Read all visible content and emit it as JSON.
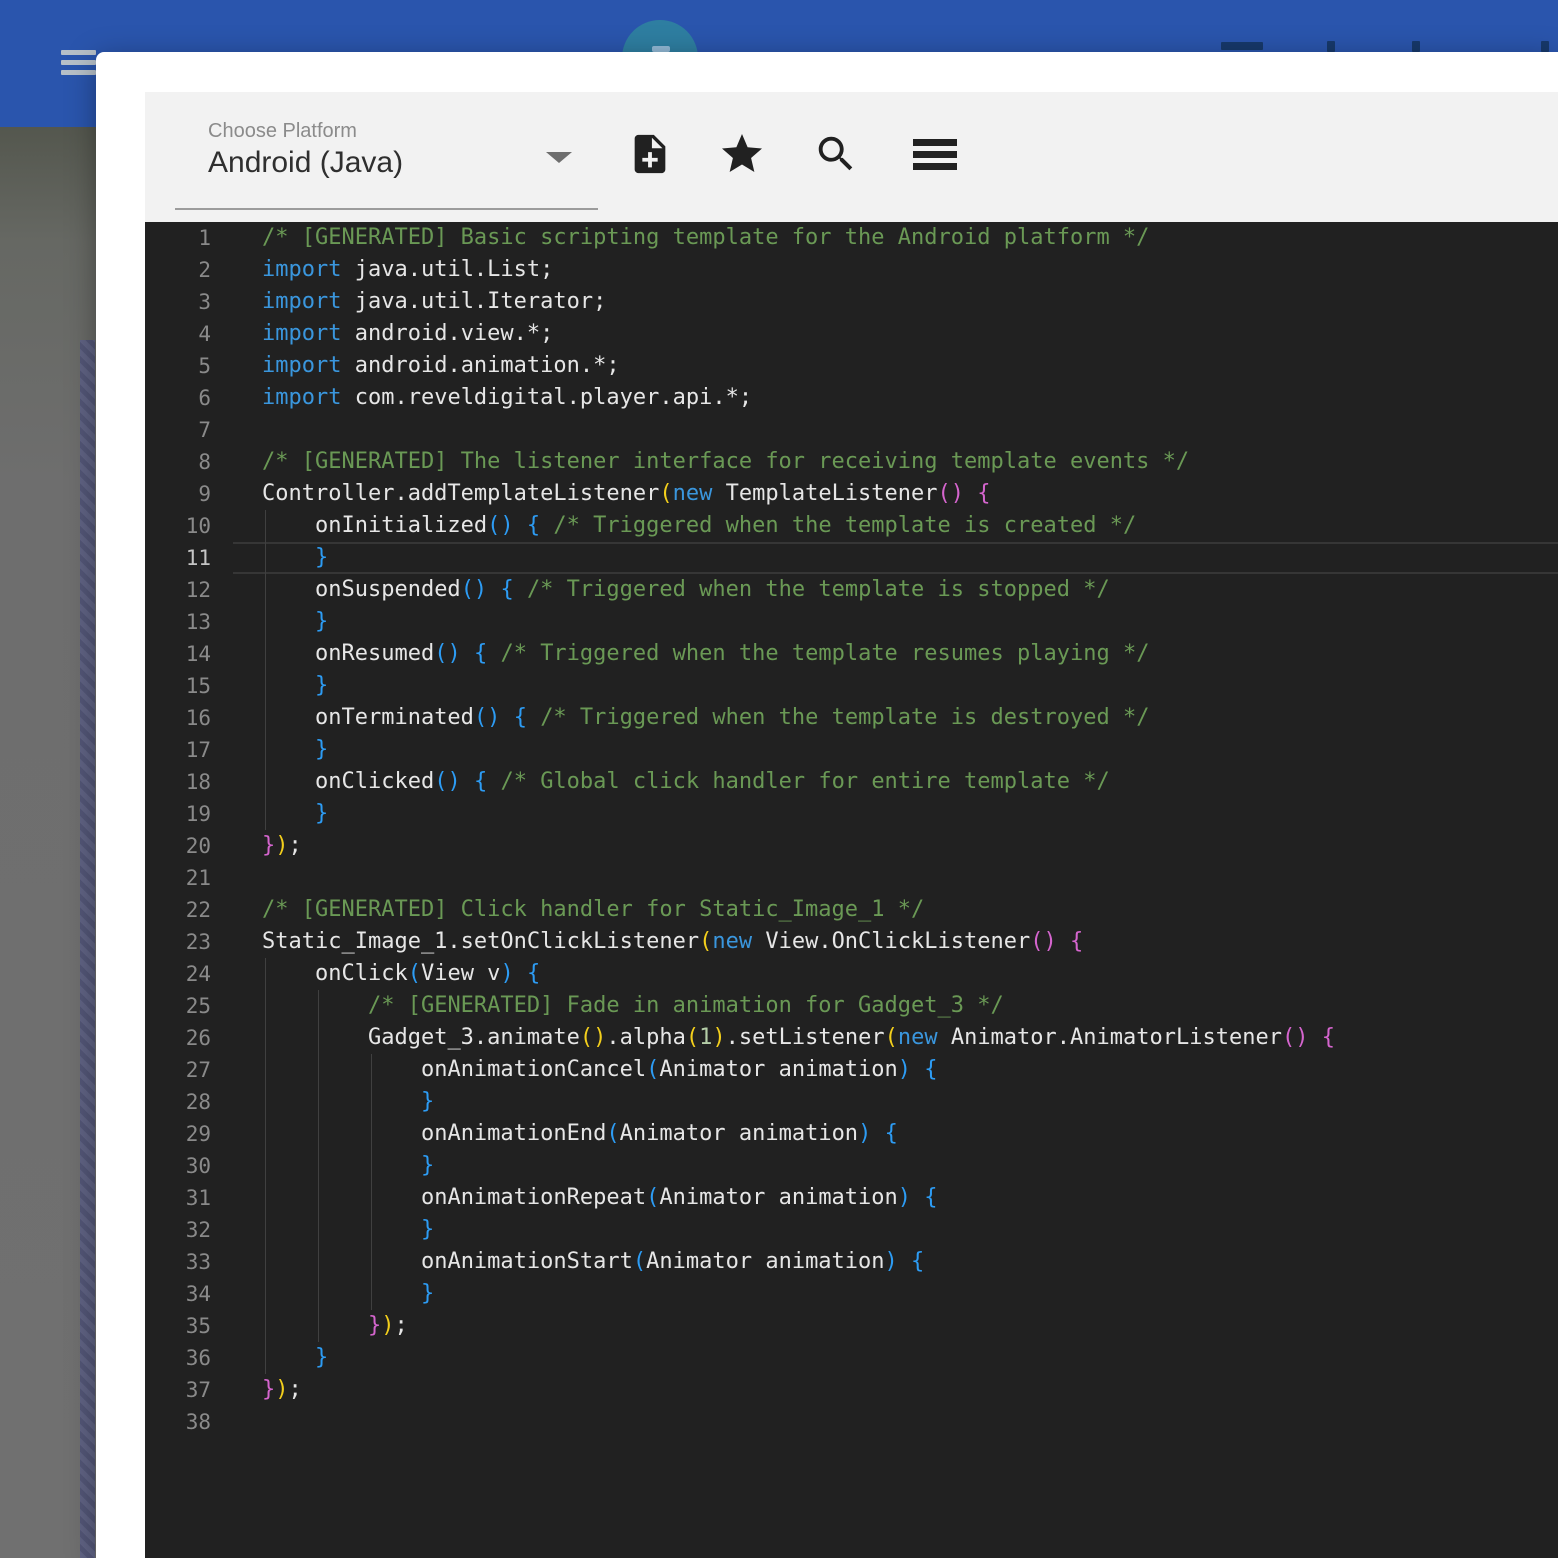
{
  "colors": {
    "app_bar_blue": "#2a55ad",
    "teal_circle": "#2e7ea1",
    "accent_strip_purple": "#575b7d",
    "modal_white": "#ffffff",
    "header_gray": "#f2f2f2",
    "icon_dark": "#212121",
    "editor_bg": "#212121",
    "line_number": "#8a8a8a",
    "line_number_active": "#c5c5c5",
    "indent_guide": "#404040",
    "active_line_border": "#363636",
    "token_comment": "#6a9955",
    "token_keyword": "#3a96dd",
    "token_fg": "#e6e6e6",
    "token_bracket1": "#f3cf1c",
    "token_bracket2": "#d565ce",
    "token_bracket3": "#2d9cf4",
    "token_number": "#b5cea8"
  },
  "header": {
    "platform_label": "Choose Platform",
    "platform_value": "Android (Java)",
    "toolbar_icons": [
      "note-add",
      "star",
      "search",
      "menu"
    ]
  },
  "editor": {
    "active_line": 11,
    "total_lines": 38,
    "lines": [
      {
        "n": 1,
        "ind": 0,
        "tokens": [
          [
            "c",
            "/* [GENERATED] Basic scripting template for the Android platform */"
          ]
        ]
      },
      {
        "n": 2,
        "ind": 0,
        "tokens": [
          [
            "k",
            "import"
          ],
          [
            "f",
            " java.util.List;"
          ]
        ]
      },
      {
        "n": 3,
        "ind": 0,
        "tokens": [
          [
            "k",
            "import"
          ],
          [
            "f",
            " java.util.Iterator;"
          ]
        ]
      },
      {
        "n": 4,
        "ind": 0,
        "tokens": [
          [
            "k",
            "import"
          ],
          [
            "f",
            " android.view.*;"
          ]
        ]
      },
      {
        "n": 5,
        "ind": 0,
        "tokens": [
          [
            "k",
            "import"
          ],
          [
            "f",
            " android.animation.*;"
          ]
        ]
      },
      {
        "n": 6,
        "ind": 0,
        "tokens": [
          [
            "k",
            "import"
          ],
          [
            "f",
            " com.reveldigital.player.api.*;"
          ]
        ]
      },
      {
        "n": 7,
        "ind": 0,
        "tokens": []
      },
      {
        "n": 8,
        "ind": 0,
        "tokens": [
          [
            "c",
            "/* [GENERATED] The listener interface for receiving template events */"
          ]
        ]
      },
      {
        "n": 9,
        "ind": 0,
        "tokens": [
          [
            "f",
            "Controller.addTemplateListener"
          ],
          [
            "y",
            "("
          ],
          [
            "k",
            "new"
          ],
          [
            "f",
            " TemplateListener"
          ],
          [
            "m",
            "()"
          ],
          [
            "f",
            " "
          ],
          [
            "m",
            "{"
          ]
        ]
      },
      {
        "n": 10,
        "ind": 1,
        "tokens": [
          [
            "f",
            "onInitialized"
          ],
          [
            "b",
            "()"
          ],
          [
            "f",
            " "
          ],
          [
            "b",
            "{"
          ],
          [
            "f",
            " "
          ],
          [
            "c",
            "/* Triggered when the template is created */"
          ]
        ]
      },
      {
        "n": 11,
        "ind": 1,
        "tokens": [
          [
            "b",
            "}"
          ]
        ]
      },
      {
        "n": 12,
        "ind": 1,
        "tokens": [
          [
            "f",
            "onSuspended"
          ],
          [
            "b",
            "()"
          ],
          [
            "f",
            " "
          ],
          [
            "b",
            "{"
          ],
          [
            "f",
            " "
          ],
          [
            "c",
            "/* Triggered when the template is stopped */"
          ]
        ]
      },
      {
        "n": 13,
        "ind": 1,
        "tokens": [
          [
            "b",
            "}"
          ]
        ]
      },
      {
        "n": 14,
        "ind": 1,
        "tokens": [
          [
            "f",
            "onResumed"
          ],
          [
            "b",
            "()"
          ],
          [
            "f",
            " "
          ],
          [
            "b",
            "{"
          ],
          [
            "f",
            " "
          ],
          [
            "c",
            "/* Triggered when the template resumes playing */"
          ]
        ]
      },
      {
        "n": 15,
        "ind": 1,
        "tokens": [
          [
            "b",
            "}"
          ]
        ]
      },
      {
        "n": 16,
        "ind": 1,
        "tokens": [
          [
            "f",
            "onTerminated"
          ],
          [
            "b",
            "()"
          ],
          [
            "f",
            " "
          ],
          [
            "b",
            "{"
          ],
          [
            "f",
            " "
          ],
          [
            "c",
            "/* Triggered when the template is destroyed */"
          ]
        ]
      },
      {
        "n": 17,
        "ind": 1,
        "tokens": [
          [
            "b",
            "}"
          ]
        ]
      },
      {
        "n": 18,
        "ind": 1,
        "tokens": [
          [
            "f",
            "onClicked"
          ],
          [
            "b",
            "()"
          ],
          [
            "f",
            " "
          ],
          [
            "b",
            "{"
          ],
          [
            "f",
            " "
          ],
          [
            "c",
            "/* Global click handler for entire template */"
          ]
        ]
      },
      {
        "n": 19,
        "ind": 1,
        "tokens": [
          [
            "b",
            "}"
          ]
        ]
      },
      {
        "n": 20,
        "ind": 0,
        "tokens": [
          [
            "m",
            "}"
          ],
          [
            "y",
            ")"
          ],
          [
            "f",
            ";"
          ]
        ]
      },
      {
        "n": 21,
        "ind": 0,
        "tokens": []
      },
      {
        "n": 22,
        "ind": 0,
        "tokens": [
          [
            "c",
            "/* [GENERATED] Click handler for Static_Image_1 */"
          ]
        ]
      },
      {
        "n": 23,
        "ind": 0,
        "tokens": [
          [
            "f",
            "Static_Image_1.setOnClickListener"
          ],
          [
            "y",
            "("
          ],
          [
            "k",
            "new"
          ],
          [
            "f",
            " View.OnClickListener"
          ],
          [
            "m",
            "()"
          ],
          [
            "f",
            " "
          ],
          [
            "m",
            "{"
          ]
        ]
      },
      {
        "n": 24,
        "ind": 1,
        "tokens": [
          [
            "f",
            "onClick"
          ],
          [
            "b",
            "("
          ],
          [
            "f",
            "View v"
          ],
          [
            "b",
            ")"
          ],
          [
            "f",
            " "
          ],
          [
            "b",
            "{"
          ]
        ]
      },
      {
        "n": 25,
        "ind": 2,
        "tokens": [
          [
            "c",
            "/* [GENERATED] Fade in animation for Gadget_3 */"
          ]
        ]
      },
      {
        "n": 26,
        "ind": 2,
        "tokens": [
          [
            "f",
            "Gadget_3.animate"
          ],
          [
            "y",
            "()"
          ],
          [
            "f",
            ".alpha"
          ],
          [
            "y",
            "("
          ],
          [
            "n",
            "1"
          ],
          [
            "y",
            ")"
          ],
          [
            "f",
            ".setListener"
          ],
          [
            "y",
            "("
          ],
          [
            "k",
            "new"
          ],
          [
            "f",
            " Animator.AnimatorListener"
          ],
          [
            "m",
            "()"
          ],
          [
            "f",
            " "
          ],
          [
            "m",
            "{"
          ]
        ]
      },
      {
        "n": 27,
        "ind": 3,
        "tokens": [
          [
            "f",
            "onAnimationCancel"
          ],
          [
            "b",
            "("
          ],
          [
            "f",
            "Animator animation"
          ],
          [
            "b",
            ")"
          ],
          [
            "f",
            " "
          ],
          [
            "b",
            "{"
          ]
        ]
      },
      {
        "n": 28,
        "ind": 3,
        "tokens": [
          [
            "b",
            "}"
          ]
        ]
      },
      {
        "n": 29,
        "ind": 3,
        "tokens": [
          [
            "f",
            "onAnimationEnd"
          ],
          [
            "b",
            "("
          ],
          [
            "f",
            "Animator animation"
          ],
          [
            "b",
            ")"
          ],
          [
            "f",
            " "
          ],
          [
            "b",
            "{"
          ]
        ]
      },
      {
        "n": 30,
        "ind": 3,
        "tokens": [
          [
            "b",
            "}"
          ]
        ]
      },
      {
        "n": 31,
        "ind": 3,
        "tokens": [
          [
            "f",
            "onAnimationRepeat"
          ],
          [
            "b",
            "("
          ],
          [
            "f",
            "Animator animation"
          ],
          [
            "b",
            ")"
          ],
          [
            "f",
            " "
          ],
          [
            "b",
            "{"
          ]
        ]
      },
      {
        "n": 32,
        "ind": 3,
        "tokens": [
          [
            "b",
            "}"
          ]
        ]
      },
      {
        "n": 33,
        "ind": 3,
        "tokens": [
          [
            "f",
            "onAnimationStart"
          ],
          [
            "b",
            "("
          ],
          [
            "f",
            "Animator animation"
          ],
          [
            "b",
            ")"
          ],
          [
            "f",
            " "
          ],
          [
            "b",
            "{"
          ]
        ]
      },
      {
        "n": 34,
        "ind": 3,
        "tokens": [
          [
            "b",
            "}"
          ]
        ]
      },
      {
        "n": 35,
        "ind": 2,
        "tokens": [
          [
            "m",
            "}"
          ],
          [
            "y",
            ")"
          ],
          [
            "f",
            ";"
          ]
        ]
      },
      {
        "n": 36,
        "ind": 1,
        "tokens": [
          [
            "b",
            "}"
          ]
        ]
      },
      {
        "n": 37,
        "ind": 0,
        "tokens": [
          [
            "m",
            "}"
          ],
          [
            "y",
            ")"
          ],
          [
            "f",
            ";"
          ]
        ]
      },
      {
        "n": 38,
        "ind": 0,
        "tokens": []
      }
    ]
  }
}
